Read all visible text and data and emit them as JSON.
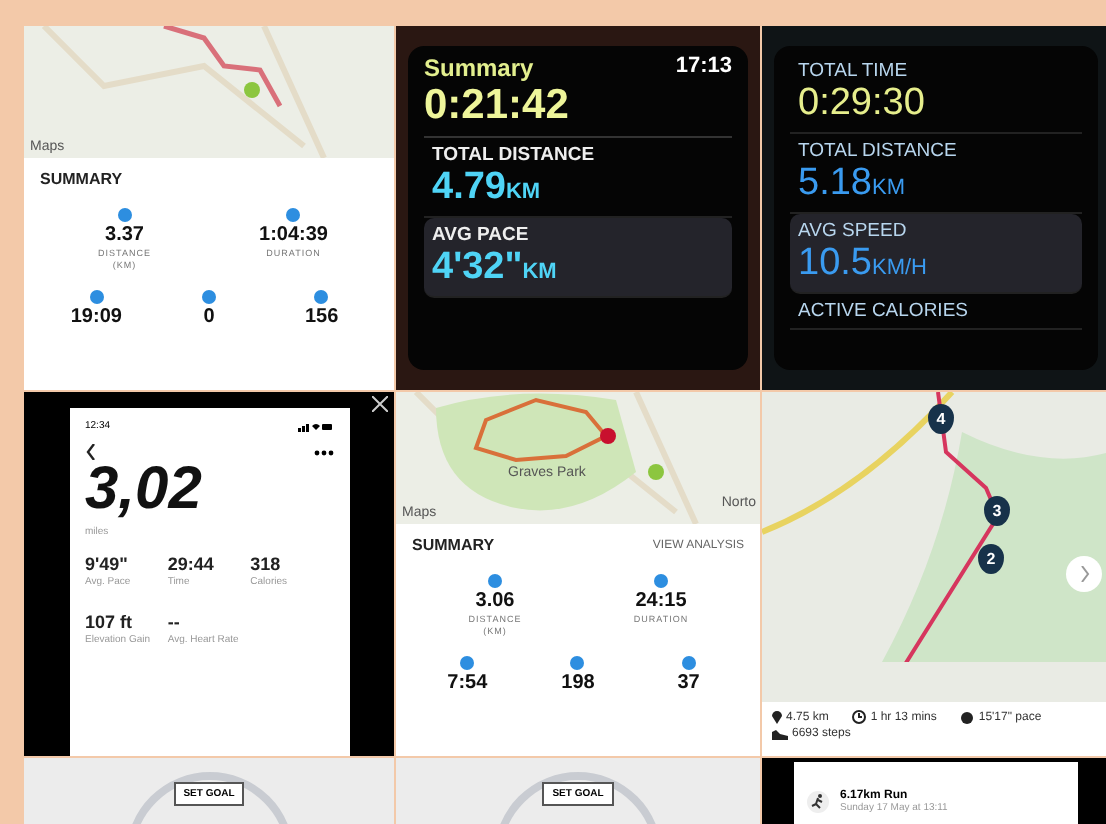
{
  "tiles": [
    {
      "kind": "summary",
      "park": false,
      "map_labels": [
        "Maps"
      ],
      "title": "SUMMARY",
      "top_stats": [
        {
          "value": "3.37",
          "label": "DISTANCE",
          "unit": "(KM)"
        },
        {
          "value": "1:04:39",
          "label": "DURATION"
        }
      ],
      "bottom_stats": [
        {
          "value": "19:09"
        },
        {
          "value": "0"
        },
        {
          "value": "156"
        }
      ]
    },
    {
      "kind": "watch",
      "header": {
        "title": "Summary",
        "time": "17:13",
        "value": "0:21:42"
      },
      "rows": [
        {
          "kind": "metric",
          "label": "TOTAL DISTANCE",
          "value": "4.79",
          "unit": "KM",
          "highlighted": false
        },
        {
          "kind": "metric",
          "label": "AVG PACE",
          "value": "4'32\"",
          "unit": "KM",
          "highlighted": true
        }
      ]
    },
    {
      "kind": "watch",
      "rows": [
        {
          "kind": "time",
          "label": "TOTAL TIME",
          "value": "0:29:30",
          "highlighted": false
        },
        {
          "kind": "metric",
          "label": "TOTAL DISTANCE",
          "value": "5.18",
          "unit": "KM",
          "highlighted": false
        },
        {
          "kind": "metric",
          "label": "AVG SPEED",
          "value": "10.5",
          "unit": "KM/H",
          "highlighted": true
        },
        {
          "kind": "label",
          "label": "ACTIVE CALORIES",
          "highlighted": false
        }
      ]
    },
    {
      "kind": "phone",
      "status_time": "12:34",
      "value": "3,02",
      "unit": "miles",
      "stats": [
        {
          "value": "9'49\"",
          "label": "Avg. Pace"
        },
        {
          "value": "29:44",
          "label": "Time"
        },
        {
          "value": "318",
          "label": "Calories"
        },
        {
          "value": "107 ft",
          "label": "Elevation Gain"
        },
        {
          "value": "--",
          "label": "Avg. Heart Rate"
        }
      ]
    },
    {
      "kind": "summary",
      "park": true,
      "map_labels": [
        "Maps",
        "Graves Park",
        "Norto"
      ],
      "title": "SUMMARY",
      "link": "VIEW ANALYSIS",
      "top_stats": [
        {
          "value": "3.06",
          "label": "DISTANCE",
          "unit": "(KM)"
        },
        {
          "value": "24:15",
          "label": "DURATION"
        }
      ],
      "bottom_stats": [
        {
          "value": "7:54"
        },
        {
          "value": "198"
        },
        {
          "value": "37"
        }
      ]
    },
    {
      "kind": "route",
      "markers": [
        "4",
        "3",
        "2"
      ],
      "stats": [
        {
          "kind": "distance",
          "text": "4.75 km"
        },
        {
          "kind": "time",
          "text": "1 hr 13 mins"
        },
        {
          "kind": "pace",
          "text": "15'17\" pace"
        },
        {
          "kind": "steps",
          "text": "6693 steps"
        }
      ]
    },
    {
      "kind": "goal",
      "button": "SET GOAL"
    },
    {
      "kind": "goal",
      "button": "SET GOAL"
    },
    {
      "kind": "activity",
      "title": "6.17km Run",
      "subtitle": "Sunday 17 May at 13:11"
    }
  ]
}
